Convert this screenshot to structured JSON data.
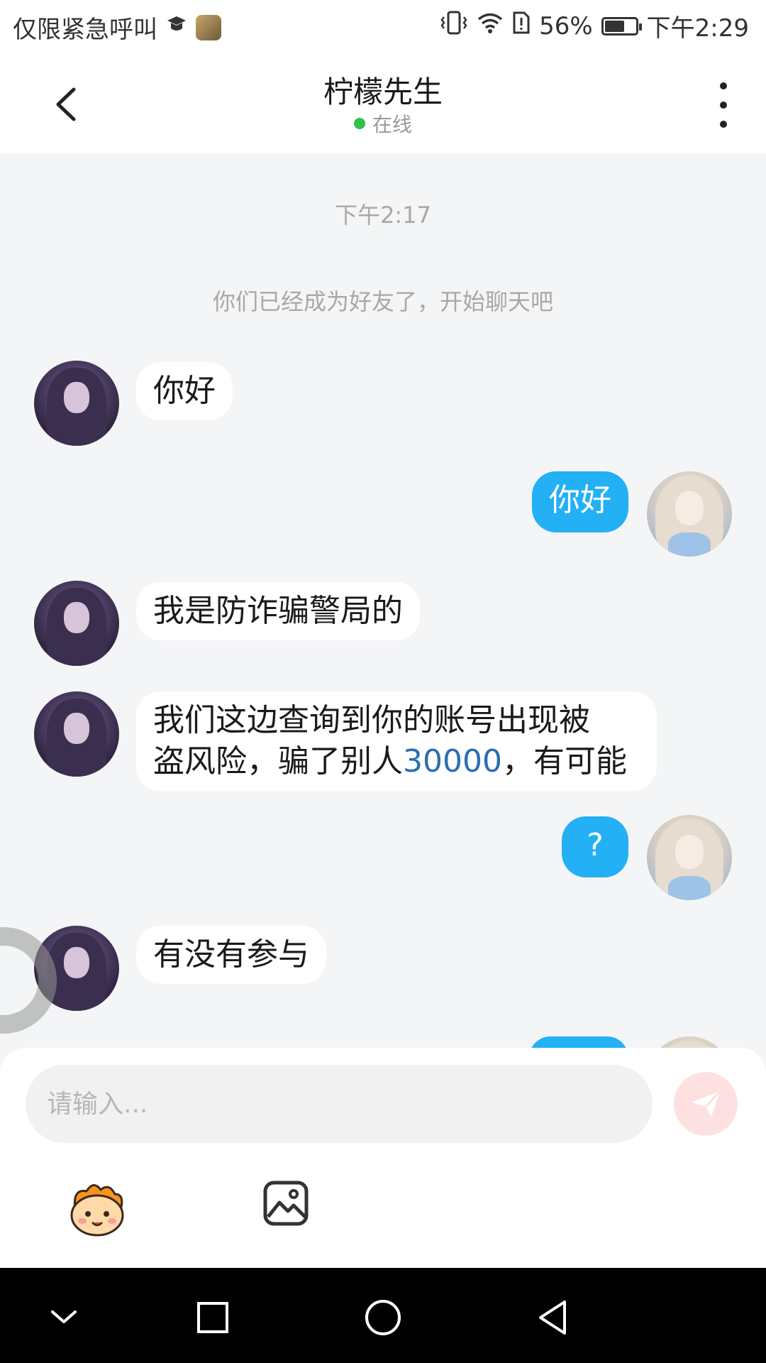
{
  "status_bar": {
    "carrier_text": "仅限紧急呼叫",
    "battery_percent": "56%",
    "time": "下午2:29"
  },
  "header": {
    "title": "柠檬先生",
    "status": "在线"
  },
  "chat": {
    "timestamp": "下午2:17",
    "system_message": "你们已经成为好友了，开始聊天吧",
    "messages": [
      {
        "side": "left",
        "text": "你好"
      },
      {
        "side": "right",
        "text": "你好"
      },
      {
        "side": "left",
        "text": "我是防诈骗警局的"
      },
      {
        "side": "left",
        "line1": "我们这边查询到你的账号出现被",
        "line2_pre": "盗风险，骗了别人",
        "line2_num": "30000",
        "line2_post": "，有可能"
      },
      {
        "side": "right",
        "text": "?"
      },
      {
        "side": "left",
        "text": "有没有参与"
      }
    ]
  },
  "composer": {
    "placeholder": "请输入..."
  },
  "icons": {
    "back": "back-arrow-icon",
    "more": "more-vertical-icon",
    "send": "send-icon",
    "emoji": "emoji-mascot-icon",
    "image": "image-icon"
  },
  "colors": {
    "accent_bubble": "#23b0f5",
    "online": "#2ec24b",
    "send_disabled": "#fde1e1"
  }
}
